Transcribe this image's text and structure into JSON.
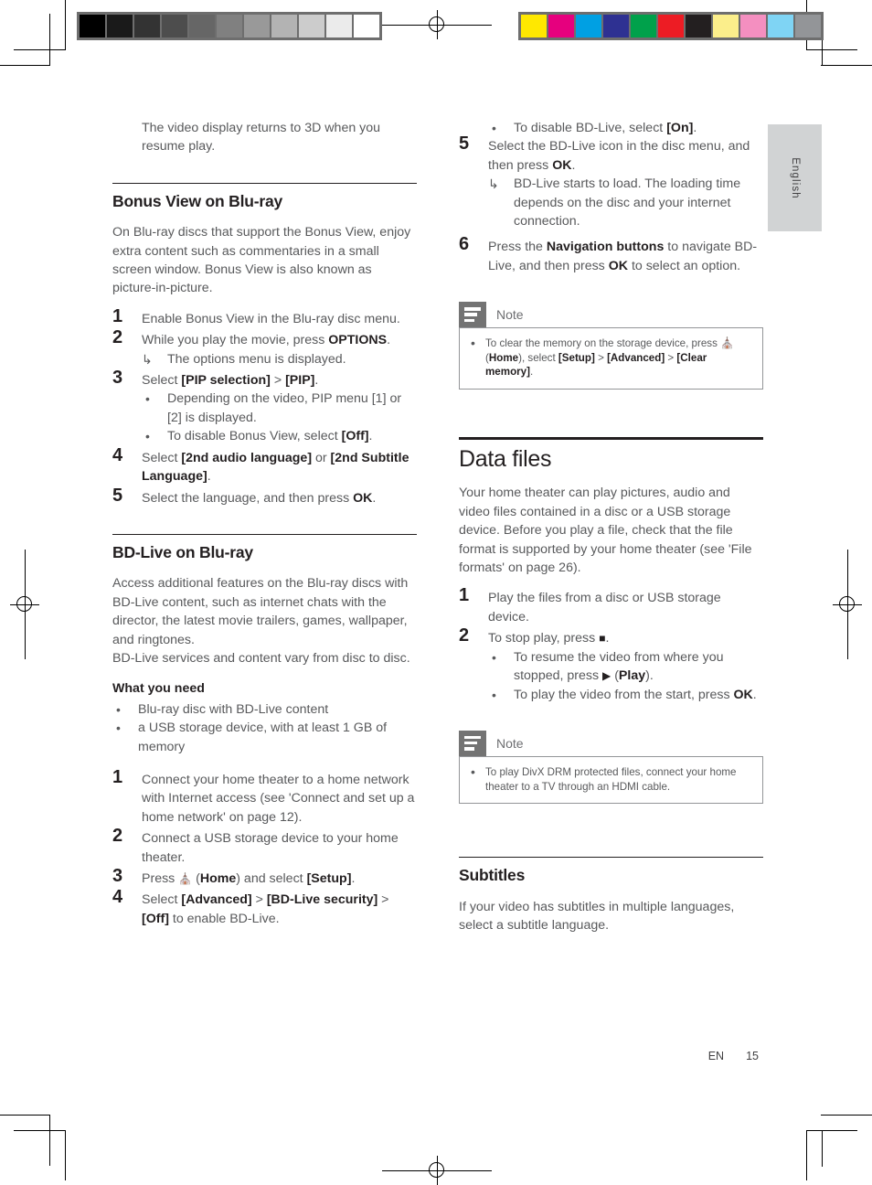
{
  "page": {
    "language_tab": "English",
    "footer_locale": "EN",
    "footer_page": "15"
  },
  "calibration": {
    "grey_swatches": [
      "#000000",
      "#1a1a1a",
      "#333333",
      "#4d4d4d",
      "#666666",
      "#808080",
      "#999999",
      "#b3b3b3",
      "#cccccc",
      "#ebebeb",
      "#ffffff"
    ],
    "color_swatches": [
      "#ffe800",
      "#e6007e",
      "#00a0e3",
      "#2e3192",
      "#00a14b",
      "#ed1c24",
      "#231f20",
      "#fbee8b",
      "#f48fc0",
      "#7fd4f4",
      "#939598"
    ]
  },
  "left_column": {
    "continued_text": "The video display returns to 3D when you resume play.",
    "bonus_view": {
      "heading": "Bonus View on Blu-ray",
      "intro": "On Blu-ray discs that support the Bonus View, enjoy extra content such as commentaries in a small screen window. Bonus View is also known as picture-in-picture.",
      "steps": [
        {
          "num": "1",
          "text": "Enable Bonus View in the Blu-ray disc menu."
        },
        {
          "num": "2",
          "text_pre": "While you play the movie, press ",
          "bold": "OPTIONS",
          "text_post": ".",
          "result": "The options menu is displayed."
        },
        {
          "num": "3",
          "text_pre": "Select ",
          "bold": "[PIP selection]",
          "mid": " > ",
          "bold2": "[PIP]",
          "text_post": ".",
          "bullets": [
            {
              "text": "Depending on the video, PIP menu [1] or [2] is displayed."
            },
            {
              "text_pre": "To disable Bonus View, select ",
              "bold": "[Off]",
              "text_post": "."
            }
          ]
        },
        {
          "num": "4",
          "text_pre": "Select ",
          "bold": "[2nd audio language]",
          "mid": " or ",
          "bold2": "[2nd Subtitle Language]",
          "text_post": "."
        },
        {
          "num": "5",
          "text_pre": "Select the language, and then press ",
          "bold": "OK",
          "text_post": "."
        }
      ]
    },
    "bd_live": {
      "heading": "BD-Live on Blu-ray",
      "intro1": "Access additional features on the Blu-ray discs with BD-Live content, such as internet chats with the director, the latest movie trailers, games, wallpaper, and ringtones.",
      "intro2": "BD-Live services and content vary from disc to disc.",
      "what_you_need_heading": "What you need",
      "what_you_need": [
        "Blu-ray disc with BD-Live content",
        "a USB storage device, with at least 1 GB of memory"
      ],
      "steps": [
        {
          "num": "1",
          "text": "Connect your home theater to a home network with Internet access (see 'Connect and set up a home network' on page 12)."
        },
        {
          "num": "2",
          "text": "Connect a USB storage device to your home theater."
        },
        {
          "num": "3",
          "text_pre": "Press ",
          "icon": "home-icon",
          "mid_pre": " (",
          "bold": "Home",
          "mid": ") and select ",
          "bold2": "[Setup]",
          "text_post": "."
        },
        {
          "num": "4",
          "text_pre": "Select ",
          "bold": "[Advanced]",
          "mid": " > ",
          "bold2": "[BD-Live security]",
          "mid2": " > ",
          "bold3": "[Off]",
          "text_post": " to enable BD-Live."
        }
      ]
    }
  },
  "right_column": {
    "bd_live_cont": {
      "lead_bullet": {
        "text_pre": "To disable BD-Live, select ",
        "bold": "[On]",
        "text_post": "."
      },
      "steps": [
        {
          "num": "5",
          "text_pre": "Select the BD-Live icon in the disc menu, and then press ",
          "bold": "OK",
          "text_post": ".",
          "result": "BD-Live starts to load. The loading time depends on the disc and your internet connection."
        },
        {
          "num": "6",
          "text_pre": "Press the ",
          "bold": "Navigation buttons",
          "mid": " to navigate BD-Live, and then press ",
          "bold2": "OK",
          "text_post": " to select an option."
        }
      ]
    },
    "note1": {
      "title": "Note",
      "text_pre": "To clear the memory on the storage device, press ",
      "icon": "home-icon",
      "mid_pre": " (",
      "bold": "Home",
      "mid": "), select ",
      "bold2": "[Setup]",
      "mid2": " > ",
      "bold3": "[Advanced]",
      "mid3": " > ",
      "bold4": "[Clear memory]",
      "text_post": "."
    },
    "data_files": {
      "heading": "Data files",
      "intro": "Your home theater can play pictures, audio and video files contained in a disc or a USB storage device. Before you play a file, check that the file format is supported by your home theater (see 'File formats' on page 26).",
      "steps": [
        {
          "num": "1",
          "text": "Play the files from a disc or USB storage device."
        },
        {
          "num": "2",
          "text_pre": "To stop play, press ",
          "icon": "stop-icon",
          "text_post": ".",
          "bullets": [
            {
              "text_pre": "To resume the video from where you stopped, press ",
              "icon": "play-icon",
              "mid": " (",
              "bold": "Play",
              "text_post": ")."
            },
            {
              "text_pre": "To play the video from the start, press ",
              "bold": "OK",
              "text_post": "."
            }
          ]
        }
      ]
    },
    "note2": {
      "title": "Note",
      "text": "To play DivX DRM protected files, connect your home theater to a TV through an HDMI cable."
    },
    "subtitles": {
      "heading": "Subtitles",
      "text": "If your video has subtitles in multiple languages, select a subtitle language."
    }
  }
}
